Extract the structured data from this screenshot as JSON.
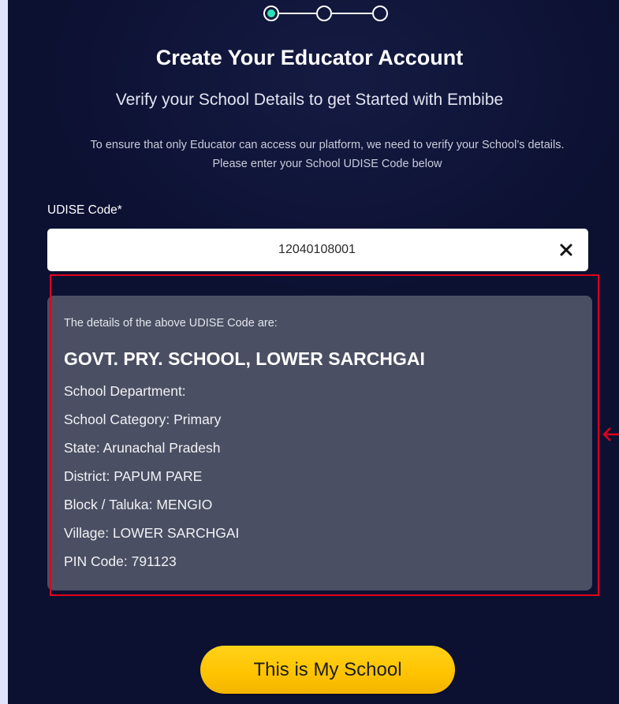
{
  "stepper": {
    "total_steps": 3,
    "current_step": 1
  },
  "header": {
    "title": "Create Your Educator Account",
    "subtitle": "Verify your School Details to get Started with Embibe",
    "info_line1": "To ensure that only Educator can access our platform, we need to verify your School’s details.",
    "info_line2": "Please enter your School UDISE Code below"
  },
  "udise": {
    "label": "UDISE Code*",
    "value": "12040108001",
    "clear_icon": "close-icon"
  },
  "details": {
    "intro": "The details of the above UDISE Code are:",
    "school_name": "GOVT. PRY. SCHOOL, LOWER SARCHGAI",
    "rows": [
      "School Department:",
      "School Category: Primary",
      "State: Arunachal Pradesh",
      "District: PAPUM PARE",
      "Block / Taluka: MENGIO",
      "Village: LOWER SARCHGAI",
      "PIN Code: 791123"
    ]
  },
  "annotation": {
    "highlight_color": "#e1001b",
    "arrow_icon": "arrow-left-icon"
  },
  "cta": {
    "label": "This is My School",
    "color": "#ffc300"
  },
  "colors": {
    "background": "#0c1132",
    "accent": "#2fe0b6",
    "card": "#4a4f63"
  }
}
